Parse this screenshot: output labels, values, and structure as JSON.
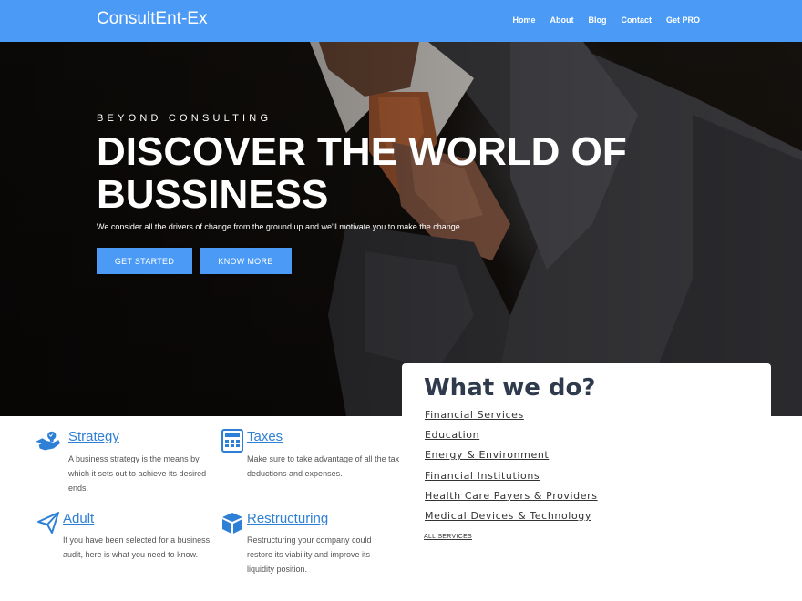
{
  "header": {
    "brand": "ConsultEnt-Ex",
    "nav": [
      "Home",
      "About",
      "Blog",
      "Contact",
      "Get PRO"
    ],
    "background_color": "#4b9bf6"
  },
  "hero": {
    "eyebrow": "BEYOND CONSULTING",
    "title": "DISCOVER THE WORLD OF BUSSINESS",
    "subtitle": "We consider all the drivers of change from the ground up and we'll motivate you to make the change.",
    "buttons": {
      "get_started": "GET STARTED",
      "know_more": "KNOW MORE"
    }
  },
  "services": [
    {
      "title": "Strategy",
      "icon": "bulb-hand-icon",
      "description": "A business strategy is the means by which it sets out to achieve its desired ends."
    },
    {
      "title": "Taxes",
      "icon": "calculator-icon",
      "description": "Make sure to take advantage of all the tax deductions and expenses."
    },
    {
      "title": "Adult",
      "icon": "paper-plane-icon",
      "description": "If you have been selected for a business audit, here is what you need to know."
    },
    {
      "title": "Restructuring",
      "icon": "cube-icon",
      "description": "Restructuring your company could restore its viability and improve its liquidity position."
    }
  ],
  "what_we_do": {
    "title": "What we do?",
    "items": [
      "Financial Services",
      "Education",
      "Energy & Environment",
      "Financial Institutions",
      "Health Care Payers & Providers",
      "Medical Devices & Technology"
    ],
    "all_link": "ALL SERVICES"
  },
  "accent_color": "#2e7fd6"
}
